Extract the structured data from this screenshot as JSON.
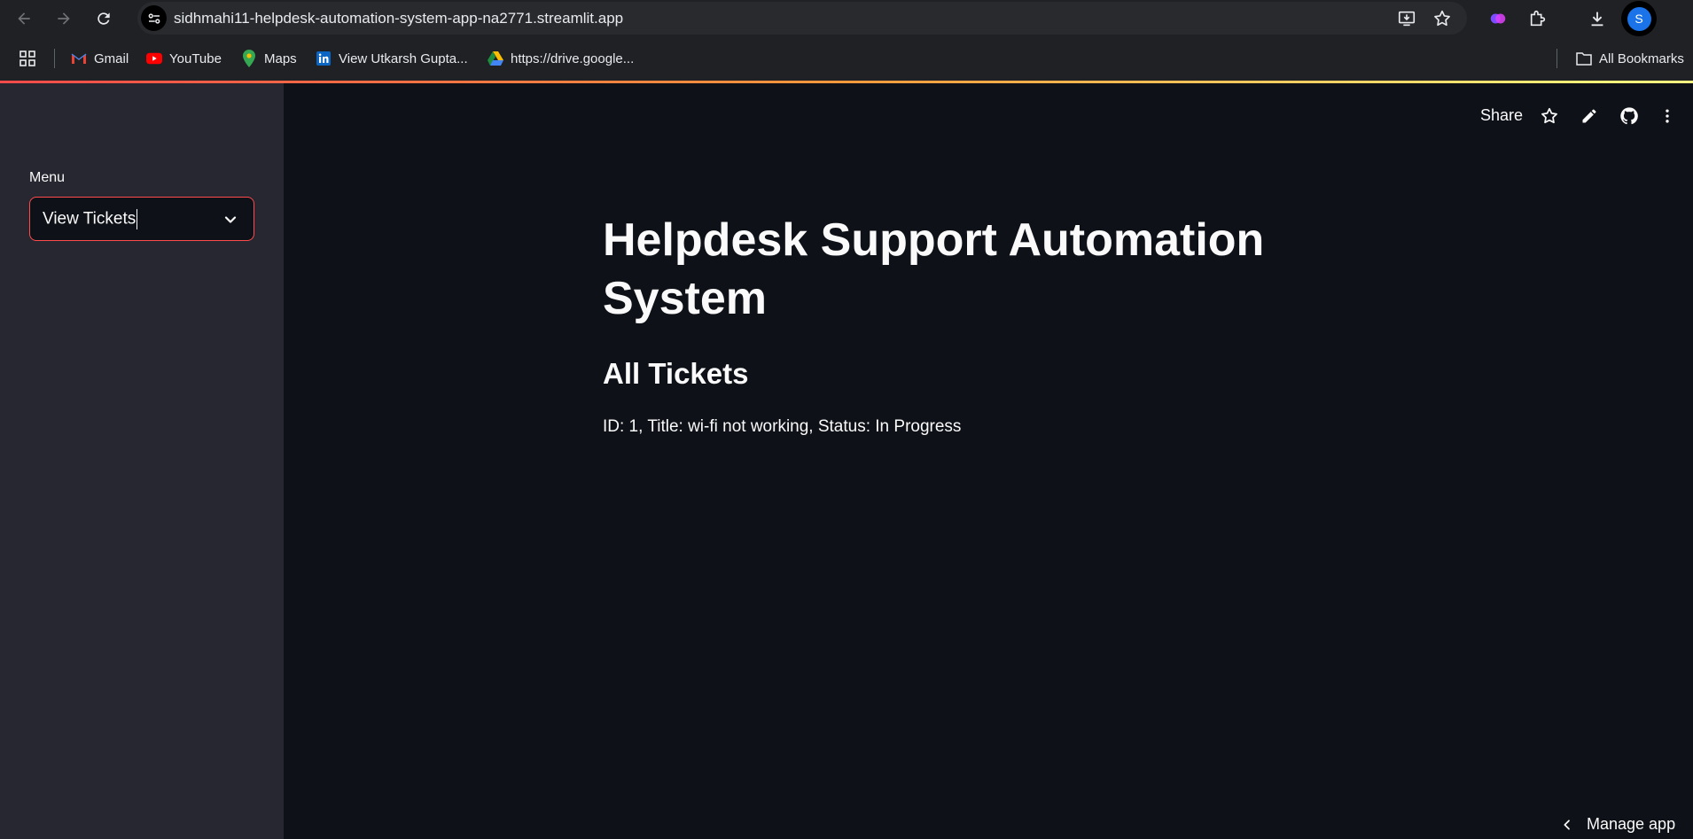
{
  "browser": {
    "url": "sidhmahi11-helpdesk-automation-system-app-na2771.streamlit.app",
    "profile_initial": "S",
    "bookmarks": [
      {
        "label": "Gmail",
        "icon": "gmail-icon"
      },
      {
        "label": "YouTube",
        "icon": "youtube-icon"
      },
      {
        "label": "Maps",
        "icon": "maps-icon"
      },
      {
        "label": "View Utkarsh Gupta...",
        "icon": "linkedin-icon"
      },
      {
        "label": "https://drive.google...",
        "icon": "google-drive-icon"
      }
    ],
    "all_bookmarks_label": "All Bookmarks"
  },
  "sidebar": {
    "menu_label": "Menu",
    "selected_option": "View Tickets"
  },
  "header": {
    "share_label": "Share"
  },
  "main": {
    "title": "Helpdesk Support Automation System",
    "subtitle": "All Tickets",
    "tickets": [
      "ID: 1, Title: wi-fi not working, Status: In Progress"
    ]
  },
  "footer": {
    "manage_app_label": "Manage app"
  },
  "colors": {
    "app_background": "#0e1117",
    "sidebar_background": "#262730",
    "accent": "#ff4b4b",
    "text": "#fafafa",
    "chrome_background": "#202124"
  }
}
